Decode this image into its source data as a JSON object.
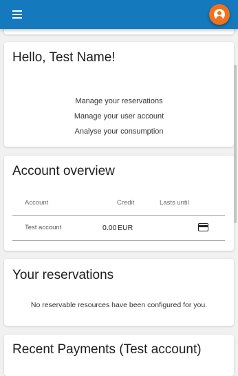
{
  "header": {
    "menu_icon": "hamburger-menu-icon",
    "avatar_icon": "account-circle-icon",
    "bar_color": "#1479bd",
    "avatar_color": "#f2711c"
  },
  "hello_card": {
    "title": "Hello, Test Name!",
    "links": [
      "Manage your reservations",
      "Manage your user account",
      "Analyse your consumption"
    ]
  },
  "account_overview": {
    "title": "Account overview",
    "columns": {
      "account": "Account",
      "credit": "Credit",
      "lasts_until": "Lasts until"
    },
    "rows": [
      {
        "account": "Test account",
        "credit": "0.00",
        "currency": "EUR",
        "lasts_until": "",
        "action_icon": "credit-card-icon"
      }
    ]
  },
  "reservations": {
    "title": "Your reservations",
    "empty_message": "No reservable resources have been configured for you."
  },
  "payments": {
    "title": "Recent Payments (Test account)"
  }
}
